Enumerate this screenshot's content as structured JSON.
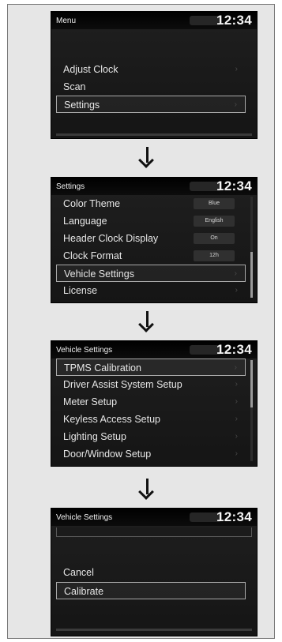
{
  "screens": [
    {
      "title": "Menu",
      "clock": "12:34",
      "items": [
        {
          "label": "Adjust Clock"
        },
        {
          "label": "Scan"
        },
        {
          "label": "Settings"
        }
      ]
    },
    {
      "title": "Settings",
      "clock": "12:34",
      "items": [
        {
          "label": "Color Theme",
          "value": "Blue"
        },
        {
          "label": "Language",
          "value": "English"
        },
        {
          "label": "Header Clock Display",
          "value": "On"
        },
        {
          "label": "Clock Format",
          "value": "12h"
        },
        {
          "label": "Vehicle Settings"
        },
        {
          "label": "License"
        }
      ]
    },
    {
      "title": "Vehicle Settings",
      "clock": "12:34",
      "items": [
        {
          "label": "TPMS Calibration"
        },
        {
          "label": "Driver Assist System Setup"
        },
        {
          "label": "Meter Setup"
        },
        {
          "label": "Keyless Access Setup"
        },
        {
          "label": "Lighting Setup"
        },
        {
          "label": "Door/Window Setup"
        }
      ]
    },
    {
      "title": "Vehicle Settings",
      "clock": "12:34",
      "items": [
        {
          "label": "Cancel"
        },
        {
          "label": "Calibrate"
        }
      ]
    }
  ],
  "icons": {
    "down_arrow": "down-arrow-icon",
    "chevron": "chevron-right-icon"
  },
  "colors": {
    "screen_bg": "#1a1a1a",
    "panel_bg": "#e6e6e6",
    "selection_border": "#a9a9a9"
  }
}
